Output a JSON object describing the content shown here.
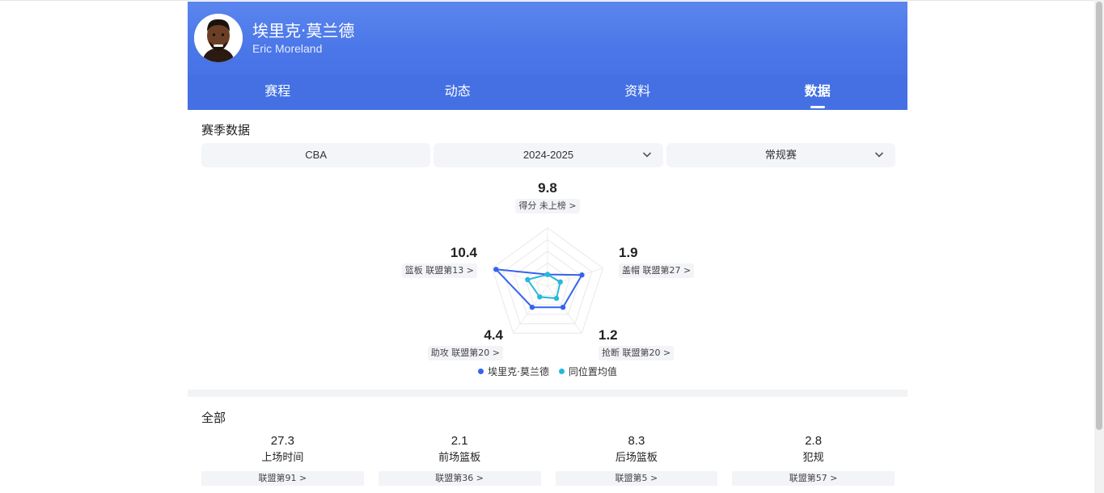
{
  "player": {
    "name_cn": "埃里克·莫兰德",
    "name_en": "Eric Moreland"
  },
  "tabs": [
    {
      "label": "赛程"
    },
    {
      "label": "动态"
    },
    {
      "label": "资料"
    },
    {
      "label": "数据",
      "active": true
    }
  ],
  "season_section": {
    "title": "赛季数据"
  },
  "filters": {
    "league": "CBA",
    "season": "2024-2025",
    "type": "常规赛"
  },
  "radar": {
    "metrics": [
      {
        "key": "points",
        "value": "9.8",
        "rank_text": "得分 未上榜"
      },
      {
        "key": "blocks",
        "value": "1.9",
        "rank_text": "盖帽 联盟第27"
      },
      {
        "key": "steals",
        "value": "1.2",
        "rank_text": "抢断 联盟第20"
      },
      {
        "key": "assists",
        "value": "4.4",
        "rank_text": "助攻 联盟第20"
      },
      {
        "key": "rebounds",
        "value": "10.4",
        "rank_text": "篮板 联盟第13"
      }
    ],
    "player_levels": [
      0.2,
      0.62,
      0.45,
      0.45,
      0.93
    ],
    "average_levels": [
      0.2,
      0.23,
      0.26,
      0.23,
      0.36
    ],
    "colors": {
      "player": "#3563ec",
      "average": "#27b8dc"
    },
    "legend": {
      "player": "埃里克·莫兰德",
      "average": "同位置均值"
    }
  },
  "all_section": {
    "title": "全部"
  },
  "stats": [
    {
      "value": "27.3",
      "label": "上场时间",
      "rank": "联盟第91"
    },
    {
      "value": "2.1",
      "label": "前场篮板",
      "rank": "联盟第36"
    },
    {
      "value": "8.3",
      "label": "后场篮板",
      "rank": "联盟第5"
    },
    {
      "value": "2.8",
      "label": "犯规",
      "rank": "联盟第57"
    }
  ]
}
